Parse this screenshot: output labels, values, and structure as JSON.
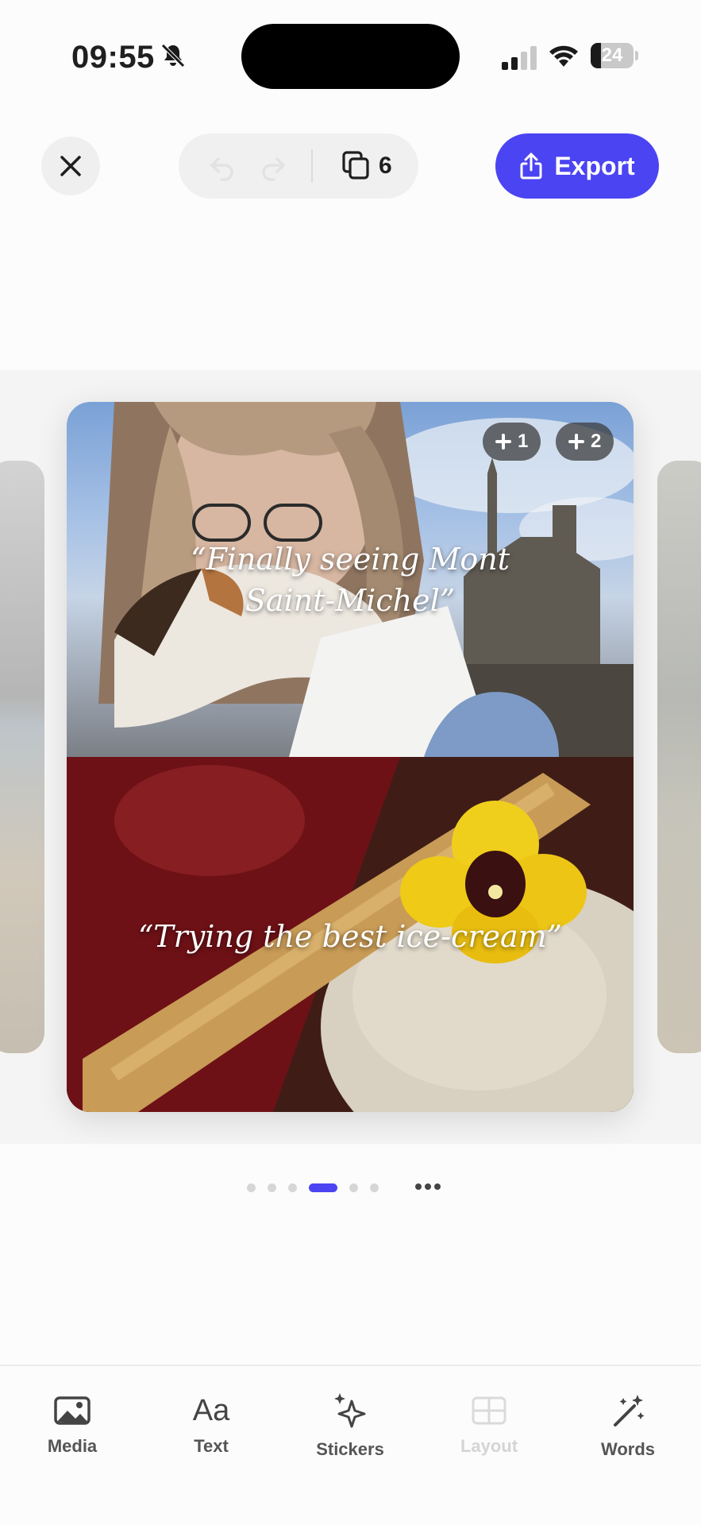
{
  "status_bar": {
    "time": "09:55",
    "battery": "24",
    "battery_level": 0.24
  },
  "toolbar": {
    "pages_count": "6",
    "export_label": "Export",
    "accent_color": "#4b44f2"
  },
  "canvas": {
    "top_quote": "“Finally seeing Mont Saint-Michel”",
    "bottom_quote": "“Trying the best ice-cream”",
    "badges": [
      {
        "label": "1"
      },
      {
        "label": "2"
      }
    ]
  },
  "pagination": {
    "total": 6,
    "active_index": 3
  },
  "tabbar": {
    "items": [
      {
        "label": "Media",
        "icon": "image-icon",
        "enabled": true
      },
      {
        "label": "Text",
        "icon": "text-aa-icon",
        "enabled": true
      },
      {
        "label": "Stickers",
        "icon": "sparkles-icon",
        "enabled": true
      },
      {
        "label": "Layout",
        "icon": "grid-icon",
        "enabled": false
      },
      {
        "label": "Words",
        "icon": "magic-wand-icon",
        "enabled": true
      }
    ],
    "text_icon_glyph": "Aa"
  }
}
